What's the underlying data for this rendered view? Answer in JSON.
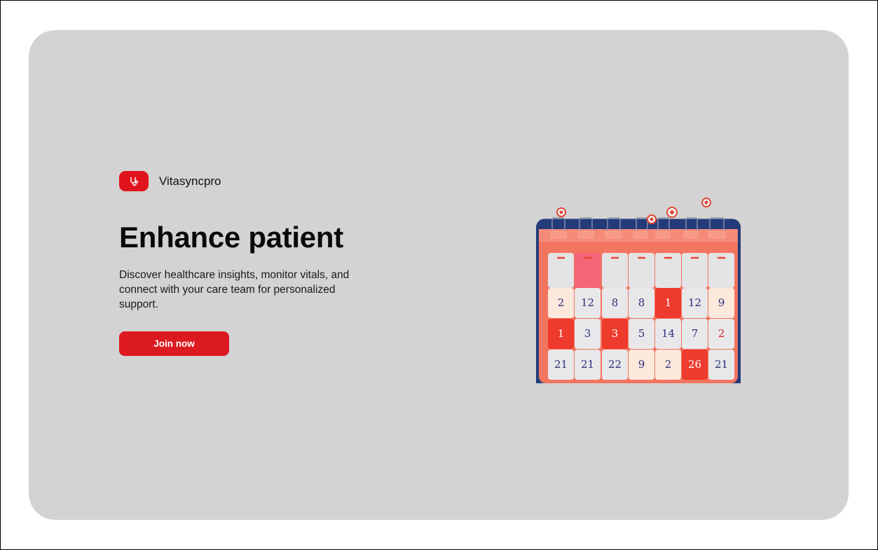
{
  "brand": {
    "name": "Vitasyncpro",
    "logo_icon": "stethoscope-icon",
    "accent_color": "#e0141e"
  },
  "hero": {
    "headline": "Enhance patient",
    "description": "Discover healthcare insights, monitor vitals, and connect with your care team for personalized support.",
    "cta_label": "Join now"
  },
  "illustration": {
    "icon": "calendar-icon",
    "cells": [
      {
        "text": "2",
        "style": "normal"
      },
      {
        "text": "12",
        "style": "normal"
      },
      {
        "text": "8",
        "style": "normal"
      },
      {
        "text": "8",
        "style": "normal"
      },
      {
        "text": "1",
        "style": "light"
      },
      {
        "text": "12",
        "style": "normal"
      },
      {
        "text": "9",
        "style": "normal"
      },
      {
        "text": "1",
        "style": "light"
      },
      {
        "text": "3",
        "style": "normal"
      },
      {
        "text": "3",
        "style": "light"
      },
      {
        "text": "5",
        "style": "normal"
      },
      {
        "text": "14",
        "style": "normal"
      },
      {
        "text": "7",
        "style": "normal"
      },
      {
        "text": "2",
        "style": "red"
      },
      {
        "text": "21",
        "style": "normal"
      },
      {
        "text": "21",
        "style": "normal"
      },
      {
        "text": "22",
        "style": "normal"
      },
      {
        "text": "9",
        "style": "normal"
      },
      {
        "text": "2",
        "style": "normal"
      },
      {
        "text": "26",
        "style": "light"
      },
      {
        "text": "21",
        "style": "normal"
      }
    ]
  }
}
